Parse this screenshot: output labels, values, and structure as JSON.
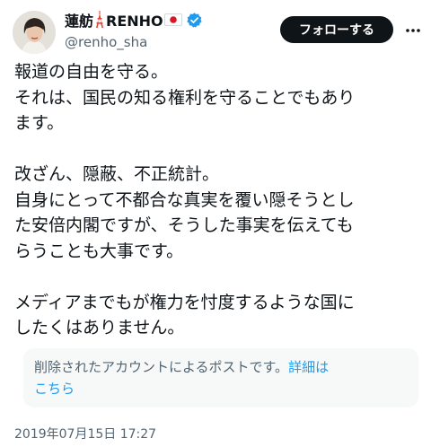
{
  "colors": {
    "text": "#0f1419",
    "secondary": "#536471",
    "link": "#1d9bf0",
    "follow_bg": "#0f1419",
    "notice_bg": "#f7f9f9"
  },
  "author": {
    "name": "蓮舫",
    "name_suffix": "RENHO",
    "tower_icon": "tokyo-tower-emoji",
    "flag_icon": "japan-flag-emoji",
    "verified_icon": "verified-badge-icon",
    "handle": "@renho_sha"
  },
  "actions": {
    "follow_label": "フォローする",
    "more_icon": "more-options-icon"
  },
  "tweet": {
    "paragraphs": [
      {
        "lines": [
          "報道の自由を守る。",
          "それは、国民の知る権利を守ることでもあり",
          "ます。"
        ]
      },
      {
        "lines": [
          "改ざん、隠蔽、不正統計。",
          "自身にとって不都合な真実を覆い隠そうとし",
          "た安倍内閣ですが、そうした事実を伝えても",
          "らうことも大事です。"
        ]
      },
      {
        "lines": [
          "メディアまでもが権力を忖度するような国に",
          "したくはありません。"
        ]
      }
    ]
  },
  "notice": {
    "text_line1": "削除されたアカウントによるポストです。",
    "link_line1": "詳細は",
    "link_line2": "こちら"
  },
  "timestamp": "2019年07月15日 17:27"
}
